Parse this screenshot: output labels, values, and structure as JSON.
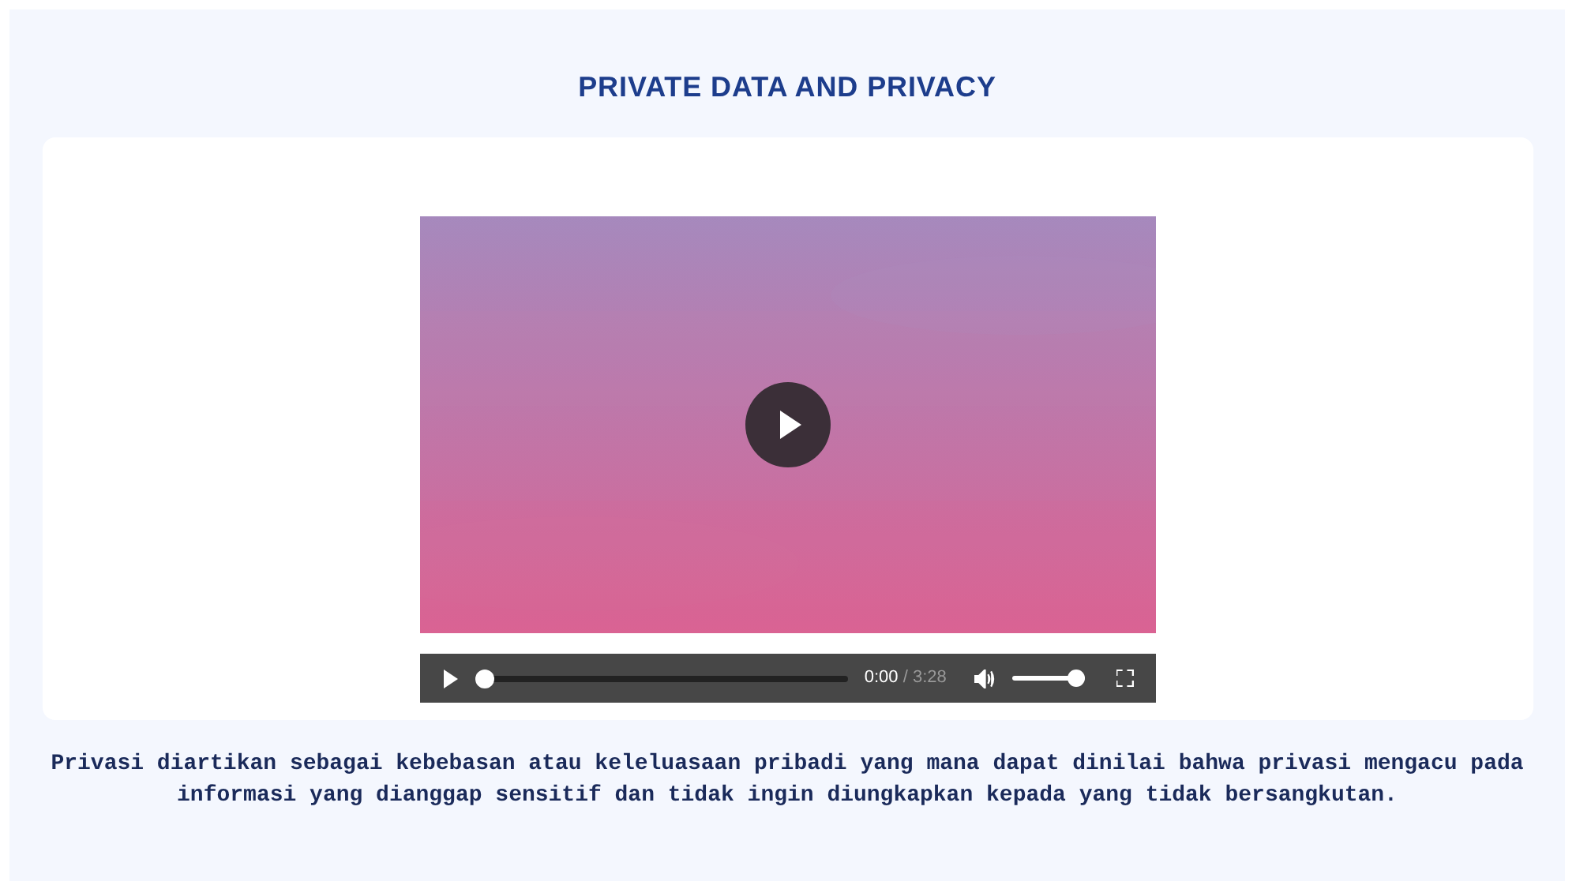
{
  "title": "PRIVATE DATA AND PRIVACY",
  "video": {
    "kind": "picture",
    "playing": false,
    "progress": {
      "level": 0.0
    },
    "time": "0:00",
    "duration": "/ 3:28",
    "volume": {
      "level": 1.0
    }
  },
  "description": "Privasi diartikan sebagai kebebasan atau keleluasaan pribadi yang mana dapat dinilai bahwa privasi mengacu pada informasi yang dianggap sensitif dan tidak ingin diungkapkan kepada yang tidak bersangkutan."
}
